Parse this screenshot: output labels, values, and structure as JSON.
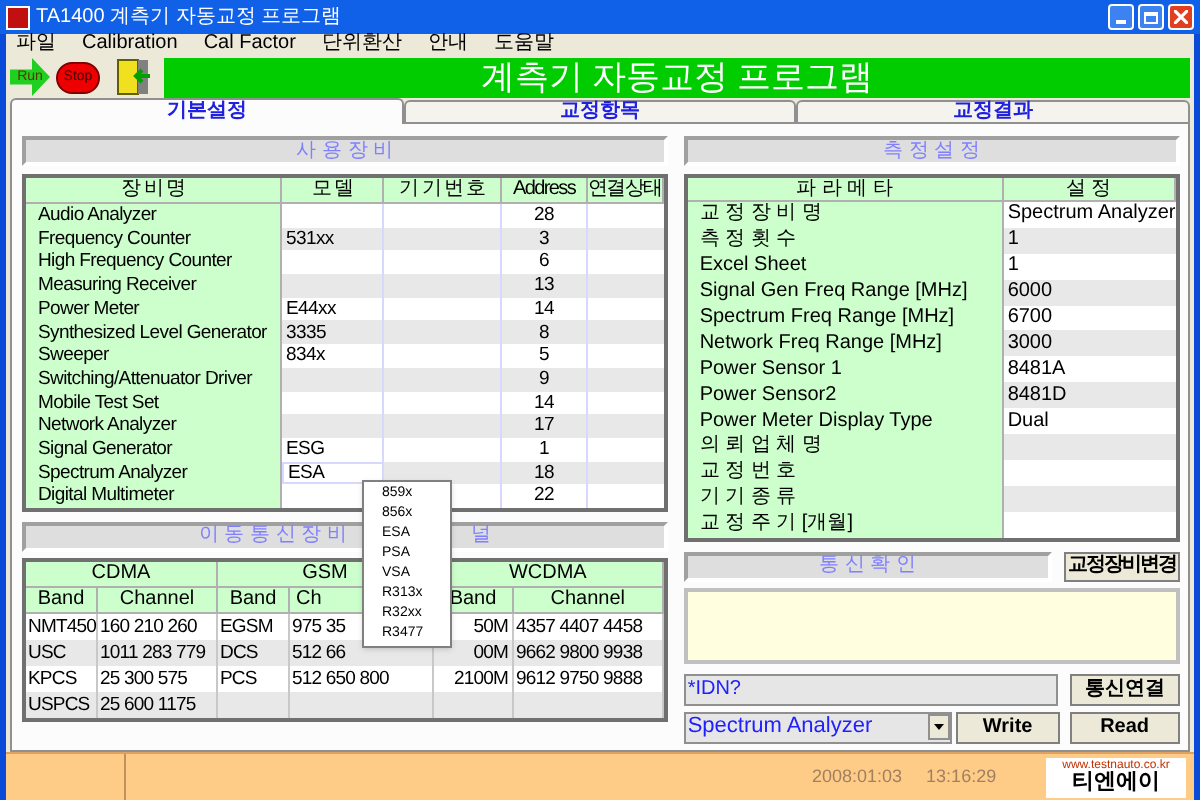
{
  "window": {
    "title": "TA1400 계측기 자동교정 프로그램"
  },
  "menu": [
    "파일",
    "Calibration",
    "Cal Factor",
    "단위환산",
    "안내",
    "도움말"
  ],
  "toolbar": {
    "run": "Run",
    "stop": "Stop",
    "banner": "계측기 자동교정 프로그램"
  },
  "tabs": [
    {
      "label": "기본설정",
      "selected": true
    },
    {
      "label": "교정항목",
      "selected": false
    },
    {
      "label": "교정결과",
      "selected": false
    }
  ],
  "devices": {
    "title": "사 용 장 비",
    "columns": [
      "장 비 명",
      "모 델",
      "기 기 번 호",
      "Address",
      "연결상태"
    ],
    "rows": [
      {
        "name": "Audio Analyzer",
        "address": "28",
        "selected": false
      },
      {
        "name": "Frequency Counter",
        "model": "531xx",
        "address": "3",
        "selected": false
      },
      {
        "name": "High Frequency Counter",
        "address": "6",
        "selected": false
      },
      {
        "name": "Measuring Receiver",
        "address": "13",
        "selected": false
      },
      {
        "name": "Power Meter",
        "model": "E44xx",
        "address": "14",
        "selected": false
      },
      {
        "name": "Synthesized Level Generator",
        "model": "3335",
        "address": "8",
        "selected": false
      },
      {
        "name": "Sweeper",
        "model": "834x",
        "address": "5",
        "selected": false
      },
      {
        "name": "Switching/Attenuator Driver",
        "address": "9",
        "selected": false
      },
      {
        "name": "Mobile Test Set",
        "address": "14",
        "selected": false
      },
      {
        "name": "Network Analyzer",
        "address": "17",
        "selected": false
      },
      {
        "name": "Signal Generator",
        "model": "ESG",
        "address": "1",
        "selected": false
      },
      {
        "name": "Spectrum Analyzer",
        "model": "ESA",
        "address": "18",
        "selected": true
      },
      {
        "name": "Digital Multimeter",
        "address": "22",
        "selected": false
      }
    ]
  },
  "model_dropdown": [
    "859x",
    "856x",
    "ESA",
    "PSA",
    "VSA",
    "R313x",
    "R32xx",
    "R3477"
  ],
  "channels": {
    "title_parts": [
      "이 동 통 신 장 비",
      "널"
    ],
    "groups": [
      "CDMA",
      "GSM",
      "WCDMA"
    ],
    "subheaders": [
      "Band",
      "Channel",
      "Band",
      "Ch",
      "Band",
      "Channel"
    ],
    "rows": [
      [
        "NMT450",
        "160 210 260",
        "EGSM",
        "975 35",
        "50M",
        "4357 4407 4458"
      ],
      [
        "USC",
        "1011 283 779",
        "DCS",
        "512 66",
        "00M",
        "9662 9800 9938"
      ],
      [
        "KPCS",
        "25 300 575",
        "PCS",
        "512 650 800",
        "2100M",
        "9612 9750 9888"
      ],
      [
        "USPCS",
        "25 600 1175",
        "",
        "",
        "",
        ""
      ]
    ]
  },
  "settings": {
    "title": "측 정 설 정",
    "columns": [
      "파 라 메 타",
      "설 정"
    ],
    "rows": [
      {
        "name": "교 정 장 비 명",
        "value": "Spectrum Analyzer"
      },
      {
        "name": "측 정 횟 수",
        "value": "1"
      },
      {
        "name": "Excel Sheet",
        "value": "1"
      },
      {
        "name": "Signal Gen Freq Range [MHz]",
        "value": "6000"
      },
      {
        "name": "Spectrum Freq Range [MHz]",
        "value": "6700"
      },
      {
        "name": "Network Freq Range [MHz]",
        "value": "3000"
      },
      {
        "name": "Power Sensor 1",
        "value": "8481A"
      },
      {
        "name": "Power Sensor2",
        "value": "8481D"
      },
      {
        "name": "Power Meter Display Type",
        "value": "Dual"
      },
      {
        "name": "의 뢰 업 체 명"
      },
      {
        "name": "교 정 번 호"
      },
      {
        "name": "기 기 종 류"
      },
      {
        "name": "교 정 주 기 [개월]"
      }
    ]
  },
  "comm": {
    "title": "통 신 확 인",
    "change_button": "교정장비변경",
    "command": "*IDN?",
    "connect_button": "통신연결",
    "device": "Spectrum Analyzer",
    "write_button": "Write",
    "read_button": "Read"
  },
  "status_bar": {
    "date": "2008:01:03",
    "time": "13:16:29",
    "url": "www.testnauto.co.kr",
    "brand": "티엔에이"
  }
}
